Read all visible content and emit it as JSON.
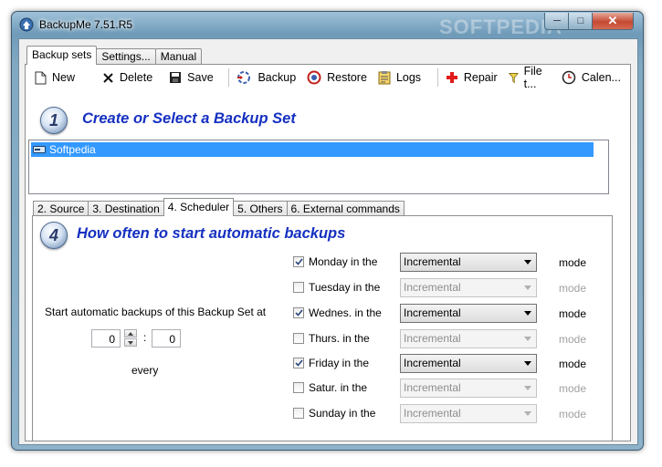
{
  "window": {
    "title": "BackupMe 7.51.R5",
    "watermark": "SOFTPEDIA"
  },
  "caption_buttons": {
    "minimize": "─",
    "maximize": "□",
    "close": "✕"
  },
  "top_tabs": [
    {
      "label": "Backup sets",
      "active": true
    },
    {
      "label": "Settings...",
      "active": false
    },
    {
      "label": "Manual",
      "active": false
    }
  ],
  "toolbar": {
    "new": "New",
    "delete": "Delete",
    "save": "Save",
    "backup": "Backup",
    "restore": "Restore",
    "logs": "Logs",
    "repair": "Repair",
    "file": "File t...",
    "calendar": "Calen..."
  },
  "section1": {
    "number": "1",
    "heading": "Create or Select a Backup Set"
  },
  "backup_sets": [
    "Softpedia"
  ],
  "sub_tabs": [
    {
      "label": "2. Source",
      "active": false
    },
    {
      "label": "3. Destination",
      "active": false
    },
    {
      "label": "4. Scheduler",
      "active": true
    },
    {
      "label": "5. Others",
      "active": false
    },
    {
      "label": "6. External commands",
      "active": false
    }
  ],
  "section4": {
    "number": "4",
    "heading": "How often to start automatic backups"
  },
  "scheduler": {
    "start_label": "Start automatic backups of this Backup Set at",
    "hour": "0",
    "minute": "0",
    "separator": ":",
    "every_label": "every",
    "mode_label": "mode",
    "days": [
      {
        "label": "Monday in the",
        "checked": true,
        "mode": "Incremental"
      },
      {
        "label": "Tuesday in the",
        "checked": false,
        "mode": "Incremental"
      },
      {
        "label": "Wednes. in the",
        "checked": true,
        "mode": "Incremental"
      },
      {
        "label": "Thurs. in the",
        "checked": false,
        "mode": "Incremental"
      },
      {
        "label": "Friday in the",
        "checked": true,
        "mode": "Incremental"
      },
      {
        "label": "Satur. in the",
        "checked": false,
        "mode": "Incremental"
      },
      {
        "label": "Sunday in the",
        "checked": false,
        "mode": "Incremental"
      }
    ]
  }
}
